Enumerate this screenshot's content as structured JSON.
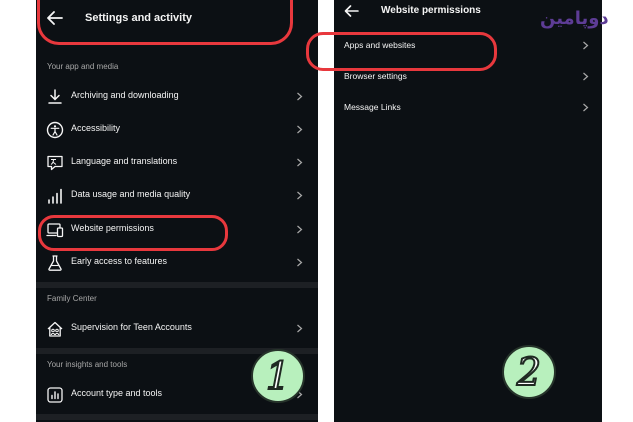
{
  "left_panel": {
    "title": "Settings and activity",
    "sections": [
      {
        "label": "Your app and media",
        "items": [
          {
            "label": "Archiving and downloading",
            "icon": "download-icon"
          },
          {
            "label": "Accessibility",
            "icon": "accessibility-icon"
          },
          {
            "label": "Language and translations",
            "icon": "language-icon"
          },
          {
            "label": "Data usage and media quality",
            "icon": "signal-bars-icon"
          },
          {
            "label": "Website permissions",
            "icon": "devices-icon"
          },
          {
            "label": "Early access to features",
            "icon": "flask-icon"
          }
        ]
      },
      {
        "label": "Family Center",
        "items": [
          {
            "label": "Supervision for Teen Accounts",
            "icon": "supervision-icon"
          }
        ]
      },
      {
        "label": "Your insights and tools",
        "items": [
          {
            "label": "Account type and tools",
            "icon": "chart-icon"
          }
        ]
      }
    ],
    "step_badge": "1"
  },
  "right_panel": {
    "title": "Website permissions",
    "items": [
      {
        "label": "Apps and websites"
      },
      {
        "label": "Browser settings"
      },
      {
        "label": "Message Links"
      }
    ],
    "step_badge": "2"
  },
  "brand_logo_text": "دوپامین",
  "colors": {
    "panel_bg": "#0c1014",
    "highlight": "#e8383d",
    "badge_fill": "#b8f0bd",
    "logo": "#5d3c95"
  }
}
